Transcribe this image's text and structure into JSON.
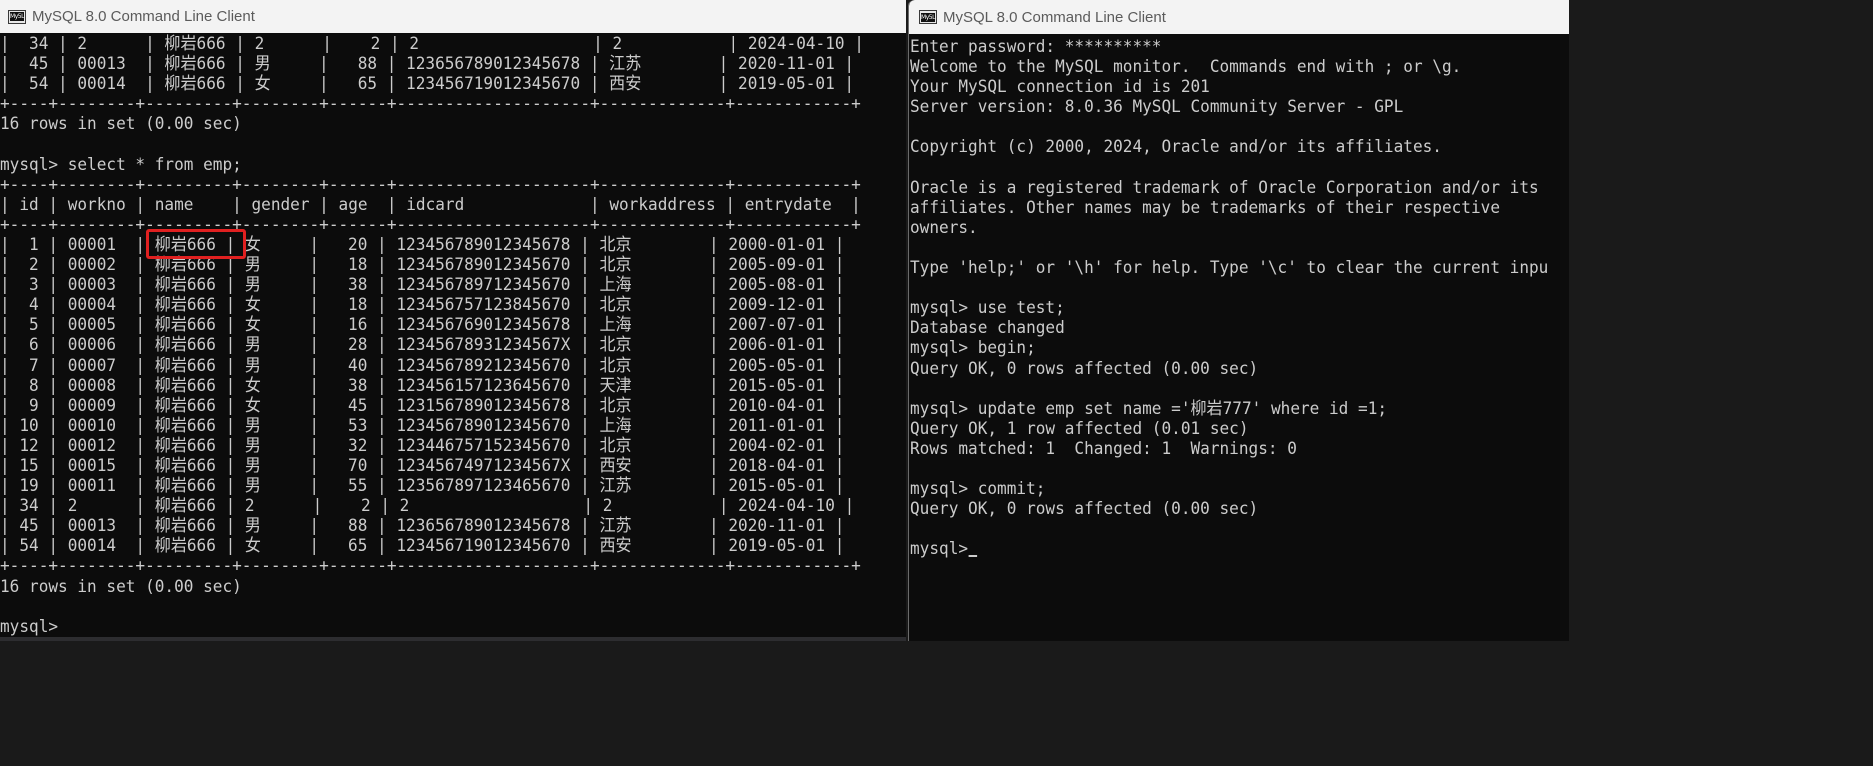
{
  "left_window": {
    "title": "MySQL 8.0 Command Line Client",
    "icon": "mysql-console-icon",
    "icon_text": "My5L",
    "lines": [
      "|  34 | 2      | 柳岩666 | 2      |    2 | 2                  | 2           | 2024-04-10 |",
      "|  45 | 00013  | 柳岩666 | 男     |   88 | 123656789012345678 | 江苏        | 2020-11-01 |",
      "|  54 | 00014  | 柳岩666 | 女     |   65 | 123456719012345670 | 西安        | 2019-05-01 |",
      "+----+--------+---------+--------+------+--------------------+-------------+------------+",
      "16 rows in set (0.00 sec)",
      "",
      "mysql> select * from emp;",
      "+----+--------+---------+--------+------+--------------------+-------------+------------+",
      "| id | workno | name    | gender | age  | idcard             | workaddress | entrydate  |",
      "+----+--------+---------+--------+------+--------------------+-------------+------------+",
      "|  1 | 00001  | 柳岩666 | 女     |   20 | 123456789012345678 | 北京        | 2000-01-01 |",
      "|  2 | 00002  | 柳岩666 | 男     |   18 | 123456789012345670 | 北京        | 2005-09-01 |",
      "|  3 | 00003  | 柳岩666 | 男     |   38 | 123456789712345670 | 上海        | 2005-08-01 |",
      "|  4 | 00004  | 柳岩666 | 女     |   18 | 123456757123845670 | 北京        | 2009-12-01 |",
      "|  5 | 00005  | 柳岩666 | 女     |   16 | 123456769012345678 | 上海        | 2007-07-01 |",
      "|  6 | 00006  | 柳岩666 | 男     |   28 | 12345678931234567X | 北京        | 2006-01-01 |",
      "|  7 | 00007  | 柳岩666 | 男     |   40 | 123456789212345670 | 北京        | 2005-05-01 |",
      "|  8 | 00008  | 柳岩666 | 女     |   38 | 123456157123645670 | 天津        | 2015-05-01 |",
      "|  9 | 00009  | 柳岩666 | 女     |   45 | 123156789012345678 | 北京        | 2010-04-01 |",
      "| 10 | 00010  | 柳岩666 | 男     |   53 | 123456789012345670 | 上海        | 2011-01-01 |",
      "| 12 | 00012  | 柳岩666 | 男     |   32 | 123446757152345670 | 北京        | 2004-02-01 |",
      "| 15 | 00015  | 柳岩666 | 男     |   70 | 12345674971234567X | 西安        | 2018-04-01 |",
      "| 19 | 00011  | 柳岩666 | 男     |   55 | 123567897123465670 | 江苏        | 2015-05-01 |",
      "| 34 | 2      | 柳岩666 | 2      |    2 | 2                  | 2           | 2024-04-10 |",
      "| 45 | 00013  | 柳岩666 | 男     |   88 | 123656789012345678 | 江苏        | 2020-11-01 |",
      "| 54 | 00014  | 柳岩666 | 女     |   65 | 123456719012345670 | 西安        | 2019-05-01 |",
      "+----+--------+---------+--------+------+--------------------+-------------+------------+",
      "16 rows in set (0.00 sec)",
      "",
      "mysql>"
    ]
  },
  "right_window": {
    "title": "MySQL 8.0 Command Line Client",
    "icon": "mysql-console-icon",
    "icon_text": "My5L",
    "lines": [
      "Enter password: **********",
      "Welcome to the MySQL monitor.  Commands end with ; or \\g.",
      "Your MySQL connection id is 201",
      "Server version: 8.0.36 MySQL Community Server - GPL",
      "",
      "Copyright (c) 2000, 2024, Oracle and/or its affiliates.",
      "",
      "Oracle is a registered trademark of Oracle Corporation and/or its",
      "affiliates. Other names may be trademarks of their respective",
      "owners.",
      "",
      "Type 'help;' or '\\h' for help. Type '\\c' to clear the current inpu",
      "",
      "mysql> use test;",
      "Database changed",
      "mysql> begin;",
      "Query OK, 0 rows affected (0.00 sec)",
      "",
      "mysql> update emp set name ='柳岩777' where id =1;",
      "Query OK, 1 row affected (0.01 sec)",
      "Rows matched: 1  Changed: 1  Warnings: 0",
      "",
      "mysql> commit;",
      "Query OK, 0 rows affected (0.00 sec)",
      "",
      "mysql>"
    ]
  },
  "annotation": {
    "highlight_color": "#e02020"
  }
}
